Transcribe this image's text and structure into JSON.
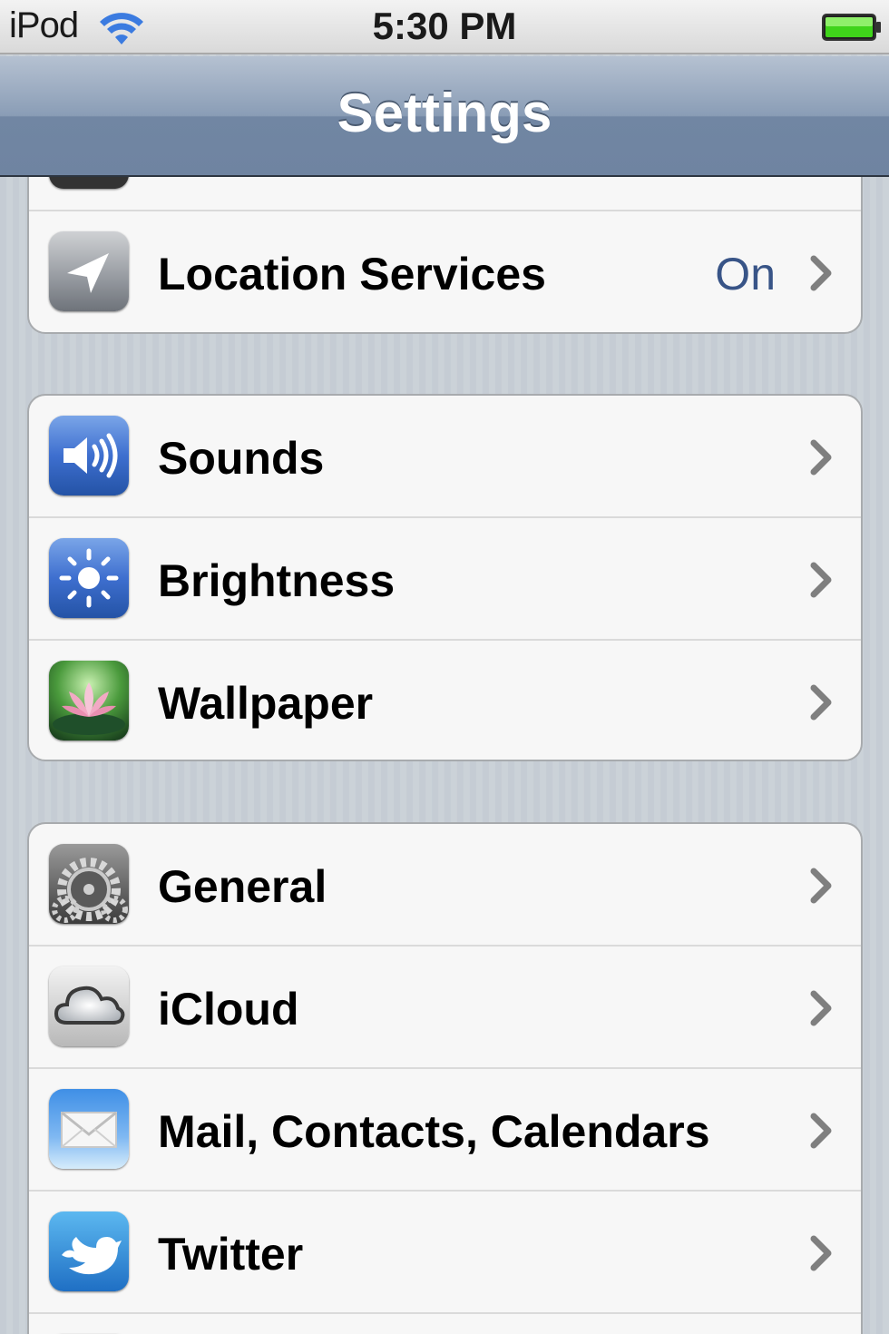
{
  "status_bar": {
    "carrier": "iPod",
    "time": "5:30 PM"
  },
  "nav_bar": {
    "title": "Settings"
  },
  "group_1": {
    "rows": [
      {
        "label": "Location Services",
        "value": "On",
        "icon": "location-arrow-icon"
      }
    ]
  },
  "group_2": {
    "rows": [
      {
        "label": "Sounds",
        "icon": "speaker-icon"
      },
      {
        "label": "Brightness",
        "icon": "sun-icon"
      },
      {
        "label": "Wallpaper",
        "icon": "lotus-flower-icon"
      }
    ]
  },
  "group_3": {
    "rows": [
      {
        "label": "General",
        "icon": "gear-icon"
      },
      {
        "label": "iCloud",
        "icon": "cloud-icon"
      },
      {
        "label": "Mail, Contacts, Calendars",
        "icon": "envelope-icon"
      },
      {
        "label": "Twitter",
        "icon": "bird-icon"
      }
    ]
  },
  "colors": {
    "value_text": "#385487",
    "nav_bar": "#7186a3",
    "background_stripes": "#c5ccd4"
  }
}
